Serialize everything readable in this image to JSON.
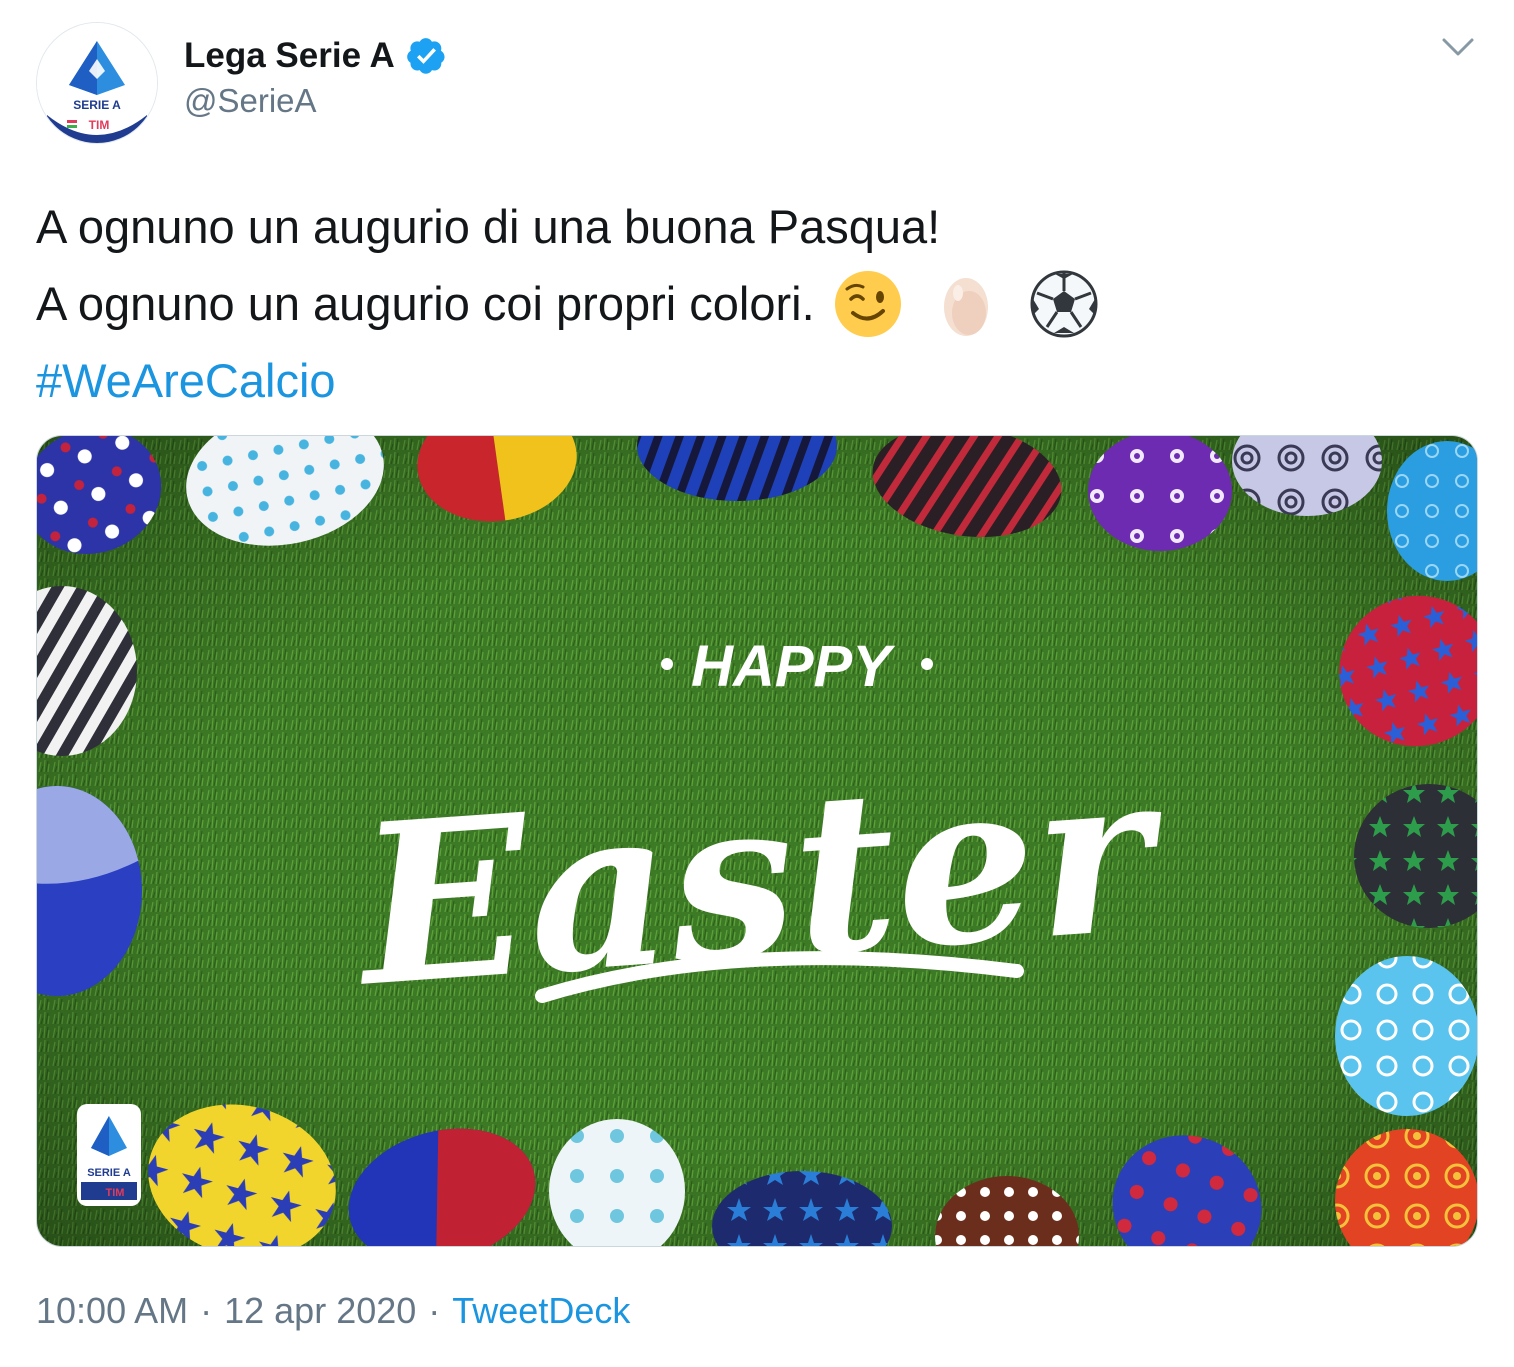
{
  "author": {
    "display_name": "Lega Serie A",
    "handle": "@SerieA",
    "verified_icon": "verified-badge-icon",
    "avatar_logo_text": "SERIE A",
    "avatar_logo_subtext": "TIM"
  },
  "tweet": {
    "line1": "A ognuno un augurio di una buona Pasqua!",
    "line2": "A ognuno un augurio coi propri colori.",
    "emojis": [
      "winking-face",
      "egg",
      "soccer-ball"
    ],
    "hashtag": "#WeAreCalcio"
  },
  "media": {
    "headline_top": "HAPPY",
    "headline_script": "Easter",
    "watermark_text": "SERIE A",
    "watermark_subtext": "TIM"
  },
  "footer": {
    "time": "10:00 AM",
    "date": "12 apr 2020",
    "separator": "·",
    "source": "TweetDeck"
  },
  "colors": {
    "link": "#1b95e0",
    "secondary_text": "#657786",
    "primary_text": "#14171a",
    "grass": "#3f7d27",
    "brand_blue": "#1f5fc4"
  }
}
